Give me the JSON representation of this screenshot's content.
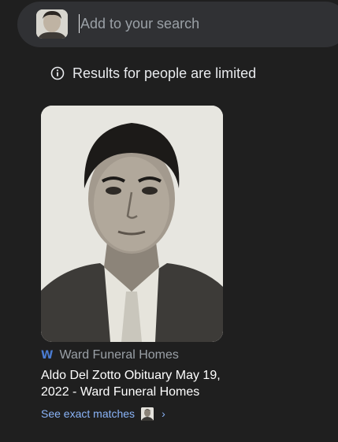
{
  "search": {
    "placeholder": "Add to your search",
    "thumbnail_icon": "portrait-thumbnail"
  },
  "notice": {
    "icon": "info-icon",
    "text": "Results for people are limited"
  },
  "result": {
    "image_icon": "portrait-photo",
    "source_icon": "W",
    "source_name": "Ward Funeral Homes",
    "title": "Aldo Del Zotto Obituary May 19, 2022 - Ward Funeral Homes",
    "see_exact_matches": "See exact matches",
    "chevron": "›"
  },
  "colors": {
    "background": "#1f1f1f",
    "search_bar": "#303134",
    "link": "#8ab4f8",
    "source_icon": "#4a7bd0"
  }
}
